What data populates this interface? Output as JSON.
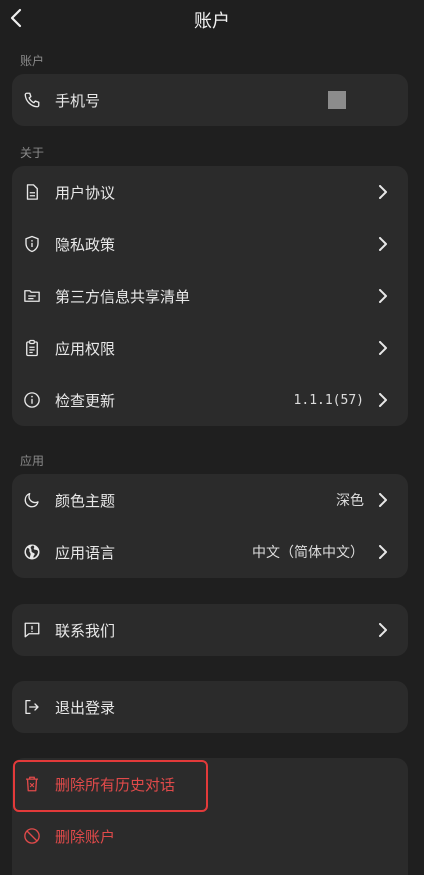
{
  "header": {
    "title": "账户"
  },
  "sections": {
    "account": {
      "label": "账户",
      "items": [
        {
          "label": "手机号"
        }
      ]
    },
    "about": {
      "label": "关于",
      "items": [
        {
          "label": "用户协议"
        },
        {
          "label": "隐私政策"
        },
        {
          "label": "第三方信息共享清单"
        },
        {
          "label": "应用权限"
        },
        {
          "label": "检查更新",
          "value": "1.1.1(57)"
        }
      ]
    },
    "app": {
      "label": "应用",
      "items": [
        {
          "label": "颜色主题",
          "value": "深色"
        },
        {
          "label": "应用语言",
          "value": "中文（简体中文）"
        }
      ]
    }
  },
  "contact": {
    "label": "联系我们"
  },
  "logout": {
    "label": "退出登录"
  },
  "danger": {
    "delete_history": "删除所有历史对话",
    "delete_account": "删除账户"
  },
  "colors": {
    "background": "#1f1f1f",
    "card": "#2b2b2b",
    "danger": "#e04a4a",
    "highlight": "#e23a3a"
  }
}
